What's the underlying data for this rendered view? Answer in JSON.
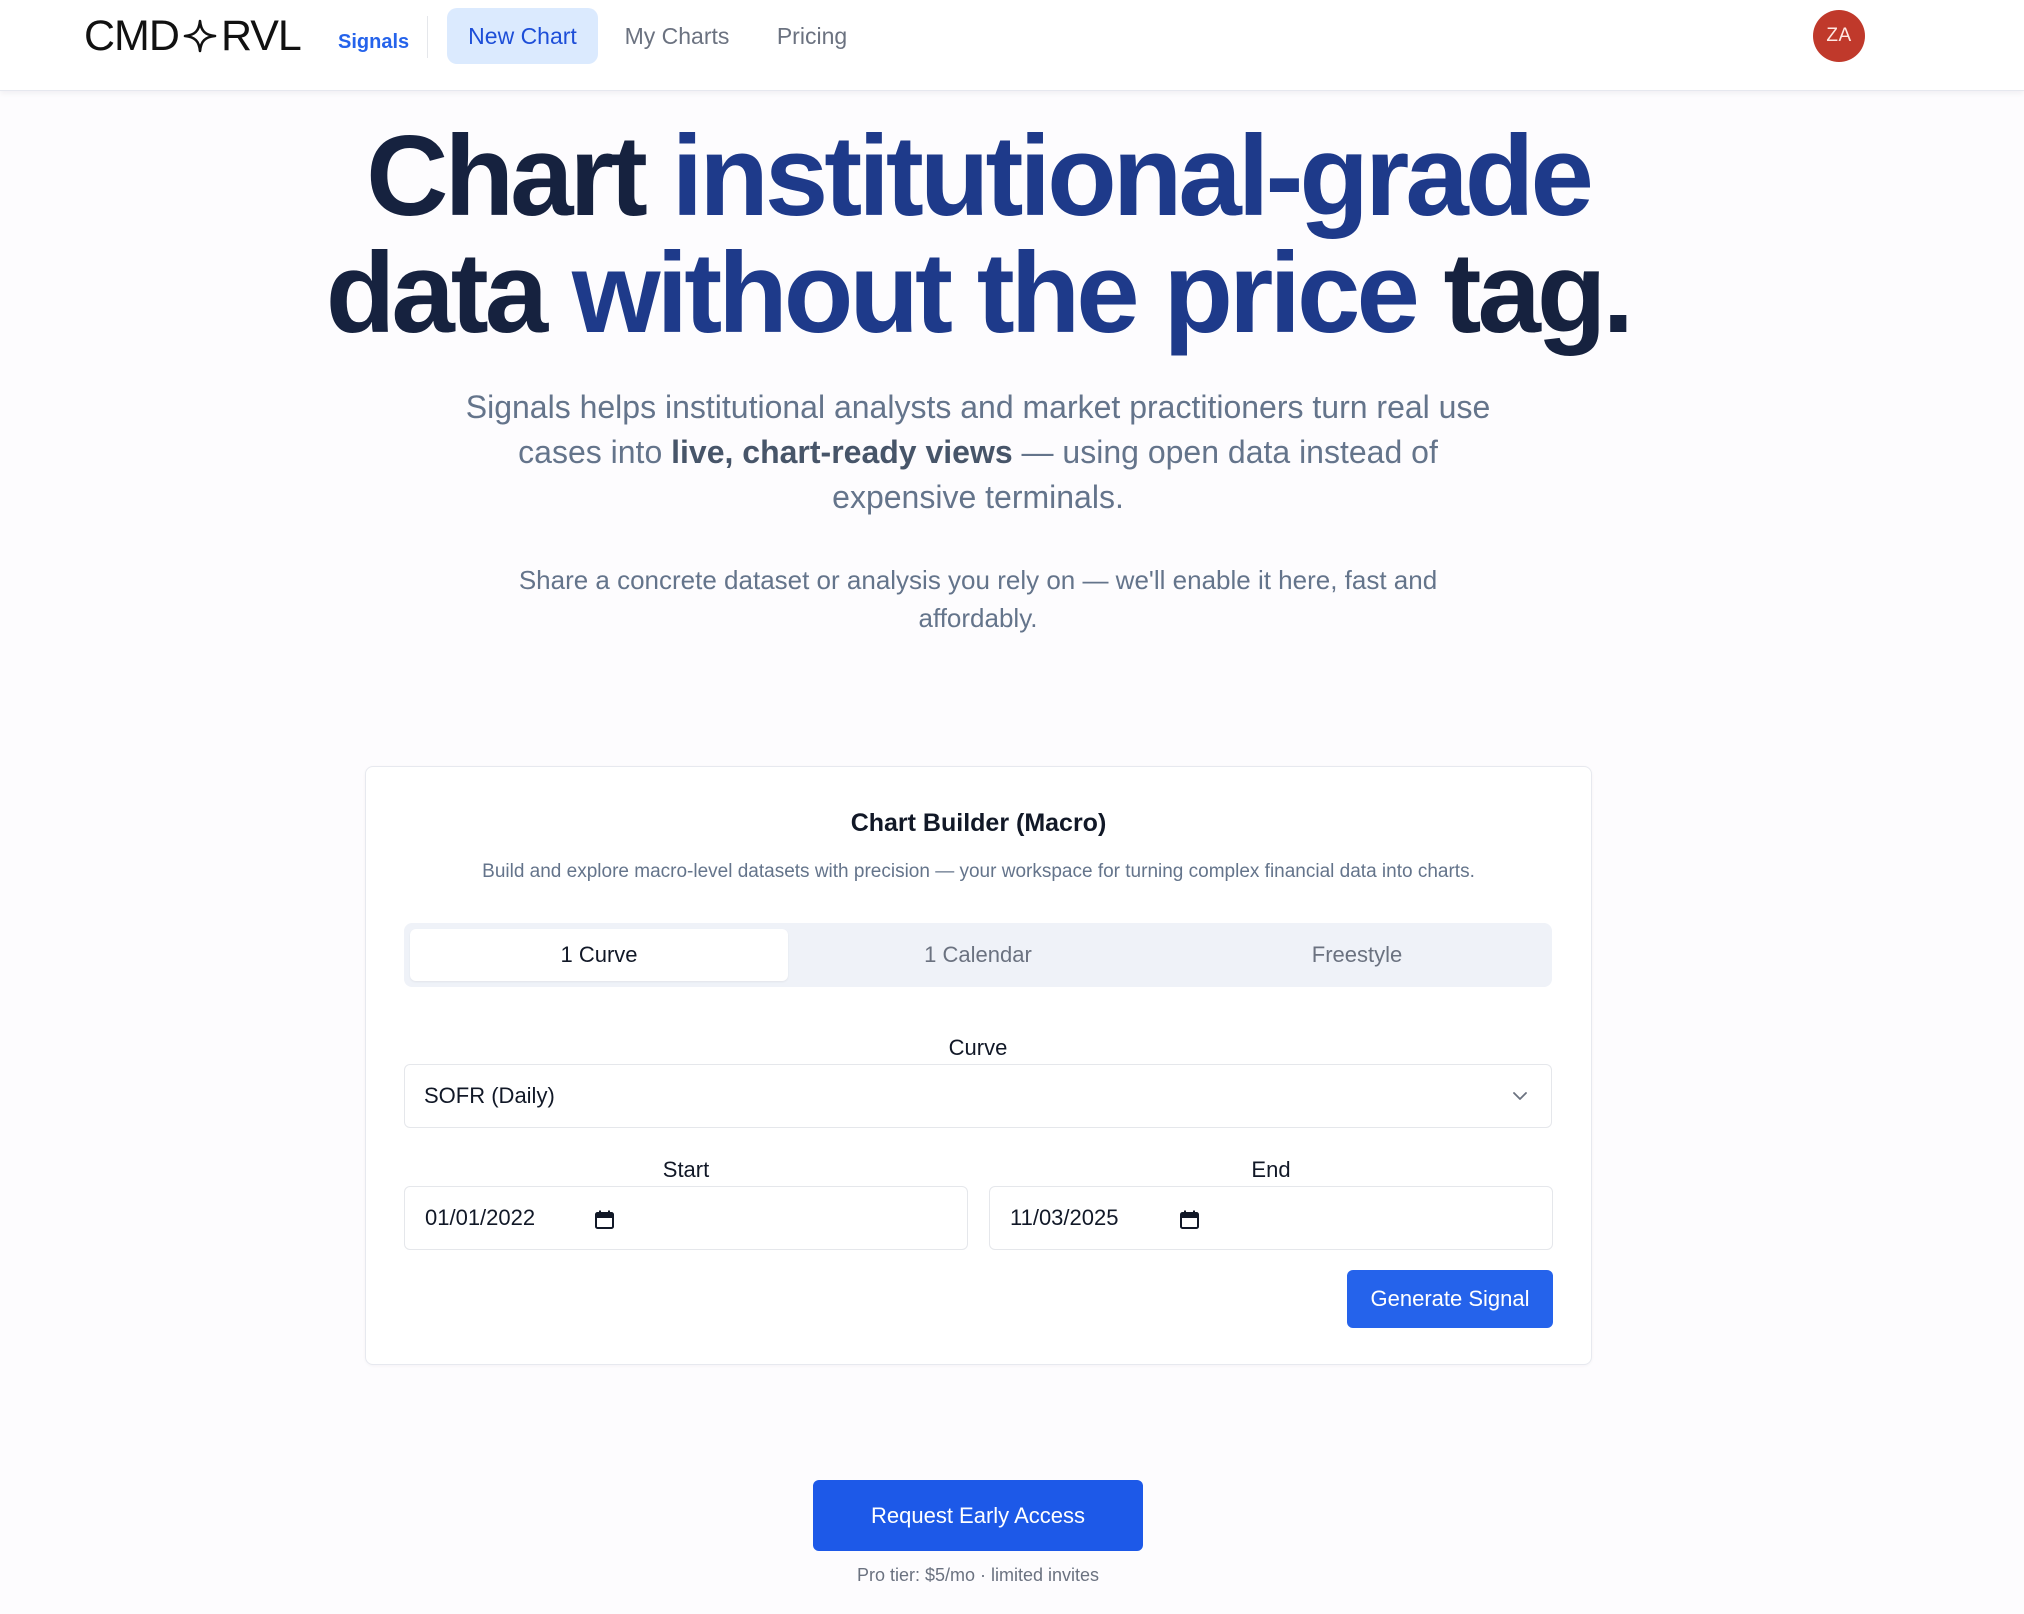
{
  "nav": {
    "logo_left": "CMD",
    "logo_right": "RVL",
    "brand_sub": "Signals",
    "links": [
      {
        "label": "New Chart",
        "active": true
      },
      {
        "label": "My Charts",
        "active": false
      },
      {
        "label": "Pricing",
        "active": false
      }
    ],
    "avatar_initials": "ZA",
    "avatar_color": "#c0392b"
  },
  "hero": {
    "title_line1_a": "Chart ",
    "title_line1_b": "institutional-grade",
    "title_line2_a": "data ",
    "title_line2_b": "without the price ",
    "title_line2_c": "tag.",
    "subtitle_a": "Signals helps institutional analysts and market practitioners turn real use cases into ",
    "subtitle_bold": "live, chart-ready views",
    "subtitle_b": " — using open data instead of expensive terminals.",
    "subtitle2": "Share a concrete dataset or analysis you rely on — we'll enable it here, fast and affordably."
  },
  "builder": {
    "title": "Chart Builder (Macro)",
    "description": "Build and explore macro-level datasets with precision — your workspace for turning complex financial data into charts.",
    "tabs": [
      {
        "label": "1 Curve",
        "active": true
      },
      {
        "label": "1 Calendar",
        "active": false
      },
      {
        "label": "Freestyle",
        "active": false
      }
    ],
    "curve_label": "Curve",
    "curve_value": "SOFR (Daily)",
    "start_label": "Start",
    "start_value": "01/01/2022",
    "end_label": "End",
    "end_value": "11/03/2025",
    "generate_label": "Generate Signal"
  },
  "cta": {
    "button_label": "Request Early Access",
    "note": "Pro tier: $5/mo · limited invites"
  },
  "colors": {
    "accent": "#2563eb",
    "title_dark": "#16223f",
    "title_blue": "#1e3a8a"
  }
}
